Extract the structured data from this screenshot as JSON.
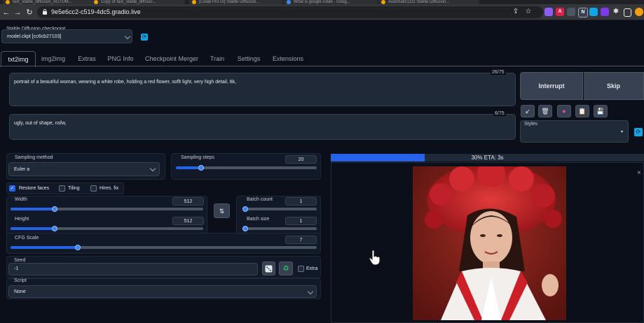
{
  "browser": {
    "url": "9e5e6cc2-c519-4dc5.gradio.live",
    "tabs": [
      {
        "label": "fast_stable_diffusion_AUTOM..."
      },
      {
        "label": "Copy of fast_stable_diffusio..."
      },
      {
        "label": "[Colab Pro UI] Stable Diffusion..."
      },
      {
        "label": "What is google colab - Goog..."
      },
      {
        "label": "Automatic1111 Stable Diffusion..."
      }
    ]
  },
  "checkpoint": {
    "label": "Stable Diffusion checkpoint",
    "value": "model.ckpt [cc6cb27103]"
  },
  "tabs": [
    {
      "label": "txt2img"
    },
    {
      "label": "img2img"
    },
    {
      "label": "Extras"
    },
    {
      "label": "PNG Info"
    },
    {
      "label": "Checkpoint Merger"
    },
    {
      "label": "Train"
    },
    {
      "label": "Settings"
    },
    {
      "label": "Extensions"
    }
  ],
  "prompt": {
    "text": "portrait of a beautiful woman, wearing a white robe, holding a red flower, soflt light, very high detail, 8k,",
    "counter": "26/75"
  },
  "negative_prompt": {
    "text": "ugly, out of shape, nsfw,",
    "counter": "6/75"
  },
  "buttons": {
    "interrupt": "Interrupt",
    "skip": "Skip"
  },
  "tools": {
    "arrow": "↙",
    "trash": "🗑",
    "extra": "●",
    "clipboard": "📋",
    "save": "💾"
  },
  "styles": {
    "label": "Styles"
  },
  "sampling_method": {
    "label": "Sampling method",
    "value": "Euler a"
  },
  "sampling_steps": {
    "label": "Sampling steps",
    "value": "20",
    "fraction": 0.18
  },
  "checkboxes": {
    "restore_faces": "Restore faces",
    "tiling": "Tiling",
    "hires_fix": "Hires. fix"
  },
  "width": {
    "label": "Width",
    "value": "512",
    "fraction": 0.23
  },
  "height": {
    "label": "Height",
    "value": "512",
    "fraction": 0.23
  },
  "swap_icon": "⇅",
  "batch_count": {
    "label": "Batch count",
    "value": "1",
    "fraction": 0.0
  },
  "batch_size": {
    "label": "Batch size",
    "value": "1",
    "fraction": 0.0
  },
  "cfg_scale": {
    "label": "CFG Scale",
    "value": "7",
    "fraction": 0.22
  },
  "seed": {
    "label": "Seed",
    "value": "-1",
    "extra_label": "Extra"
  },
  "script": {
    "label": "Script",
    "value": "None"
  },
  "progress": {
    "text": "30% ETA: 3s",
    "fraction": 0.3
  },
  "gallery": {
    "close": "×"
  },
  "colors": {
    "accent": "#2563eb",
    "background": "#0b0f19",
    "panel": "#1f2937",
    "refresh": "#0ea5e9",
    "recycle": "#22c55e"
  }
}
